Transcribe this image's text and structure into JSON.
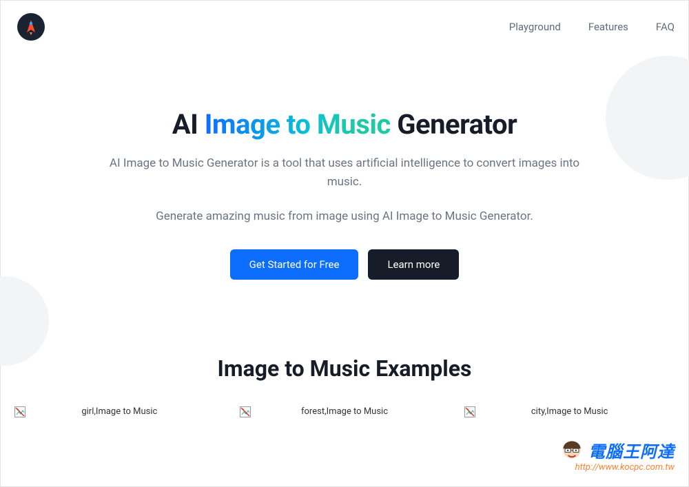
{
  "nav": {
    "items": [
      "Playground",
      "Features",
      "FAQ"
    ]
  },
  "hero": {
    "title_pre": "AI ",
    "title_gradient": "Image to Music",
    "title_post": " Generator",
    "subtitle": "AI Image to Music Generator is a tool that uses artificial intelligence to convert images into music.",
    "subtitle2": "Generate amazing music from image using AI Image to Music Generator.",
    "cta_primary": "Get Started for Free",
    "cta_secondary": "Learn more"
  },
  "examples": {
    "title": "Image to Music Examples",
    "items": [
      {
        "alt": "girl,Image to Music"
      },
      {
        "alt": "forest,Image to Music"
      },
      {
        "alt": "city,Image to Music"
      }
    ]
  },
  "watermark": {
    "text": "電腦王阿達",
    "url": "http://www.kocpc.com.tw"
  }
}
